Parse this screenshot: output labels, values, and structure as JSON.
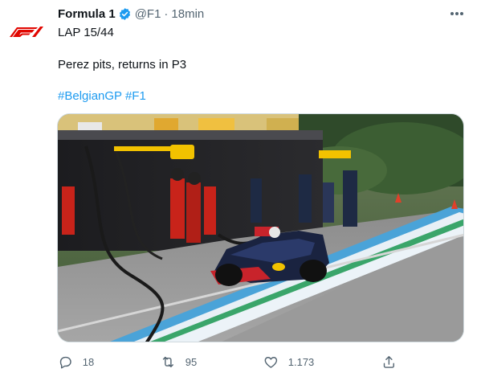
{
  "tweet": {
    "author": {
      "name": "Formula 1",
      "handle": "@F1",
      "separator": "·",
      "time": "18min"
    },
    "lines": [
      "LAP 15/44",
      "Perez pits, returns in P3"
    ],
    "hashtags": [
      "#BelgianGP",
      "#F1"
    ],
    "media": {
      "icon": "photo-pitstop"
    },
    "actions": {
      "reply": {
        "icon": "reply-icon",
        "count": "18"
      },
      "retweet": {
        "icon": "retweet-icon",
        "count": "95"
      },
      "like": {
        "icon": "heart-icon",
        "count": "1.173"
      },
      "share": {
        "icon": "share-icon"
      }
    }
  },
  "colors": {
    "accent": "#1d9bf0",
    "brand": "#e10600",
    "muted": "#536471"
  }
}
